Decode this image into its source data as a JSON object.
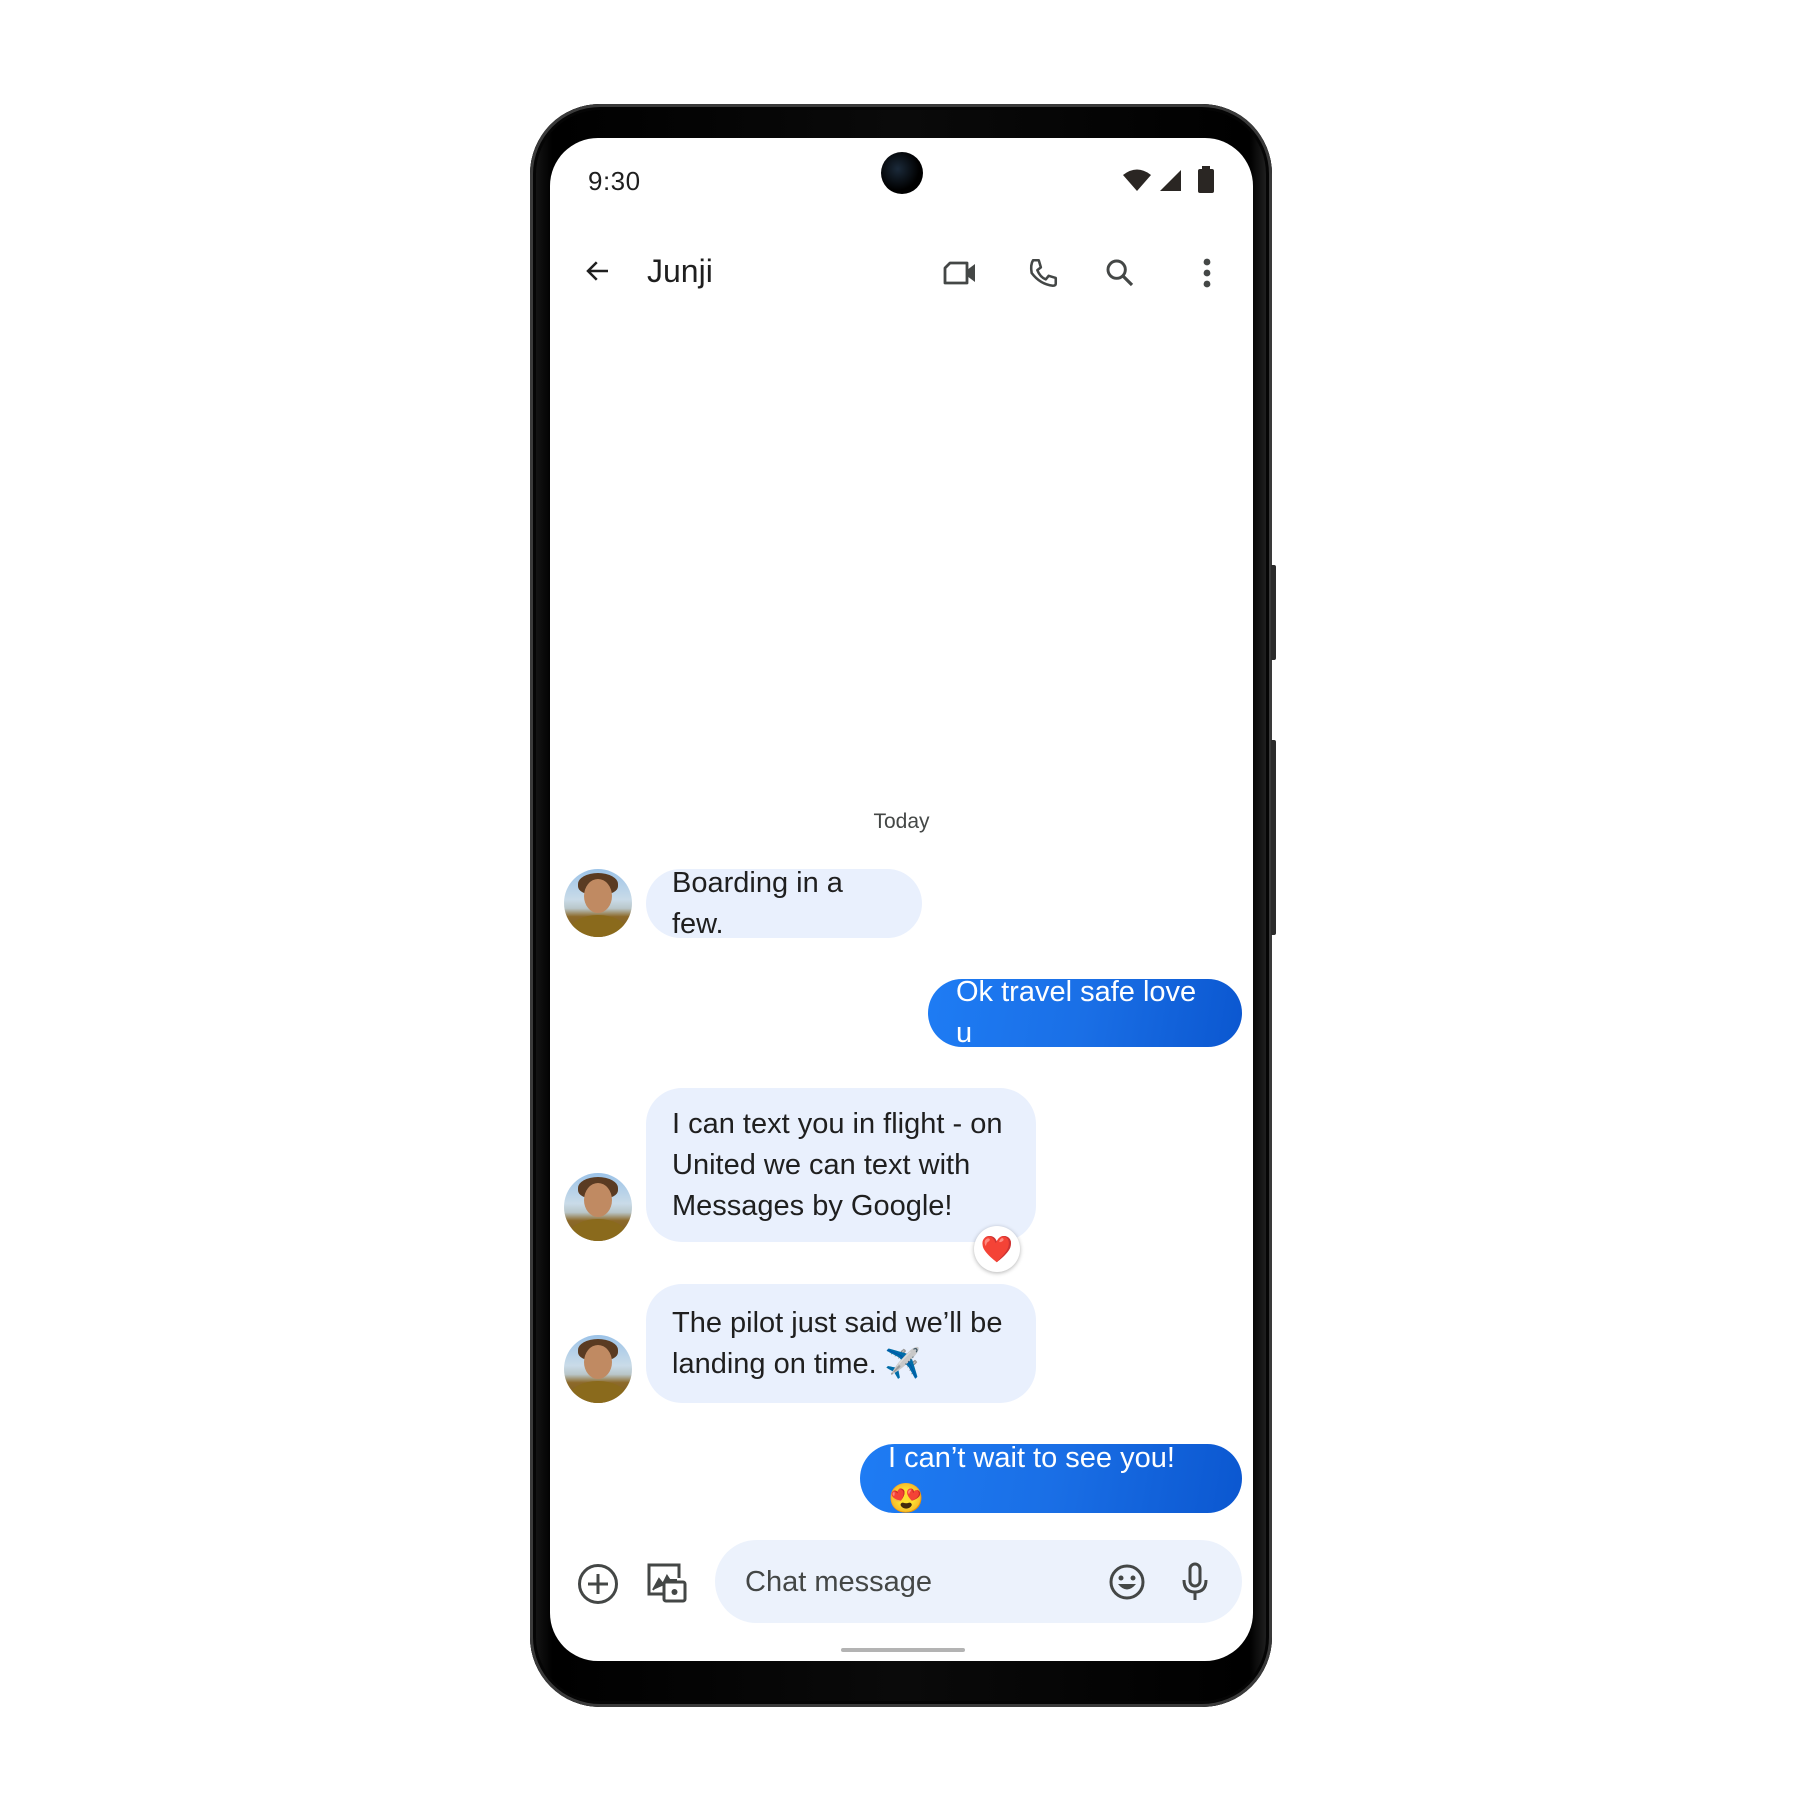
{
  "status_bar": {
    "time": "9:30",
    "icons": [
      "wifi-icon",
      "cellular-signal-icon",
      "battery-icon"
    ]
  },
  "header": {
    "back_icon": "arrow-back-icon",
    "contact_name": "Junji",
    "actions": [
      {
        "name": "video-call",
        "icon": "videocam-icon"
      },
      {
        "name": "voice-call",
        "icon": "phone-icon"
      },
      {
        "name": "search",
        "icon": "search-icon"
      },
      {
        "name": "more-options",
        "icon": "more-vert-icon"
      }
    ]
  },
  "conversation": {
    "date_divider": "Today",
    "messages": [
      {
        "direction": "incoming",
        "text": "Boarding in a few.",
        "avatar": true
      },
      {
        "direction": "outgoing",
        "text": "Ok travel safe love u"
      },
      {
        "direction": "incoming",
        "text": "I can text you in flight - on United we can text with Messages by Google!",
        "avatar": true,
        "reaction": "❤️"
      },
      {
        "direction": "incoming",
        "text": "The pilot just said we’ll be landing on time. ✈️",
        "avatar": true
      },
      {
        "direction": "outgoing",
        "text": "I can’t wait to see you! 😍"
      }
    ]
  },
  "composer": {
    "add_icon": "add-circle-icon",
    "gallery_icon": "gallery-camera-icon",
    "placeholder": "Chat message",
    "value": "",
    "emoji_icon": "emoji-icon",
    "mic_icon": "mic-icon"
  },
  "colors": {
    "outgoing_bubble_start": "#1e7cf4",
    "outgoing_bubble_end": "#0b57d0",
    "incoming_bubble": "#e9f0fd",
    "composer_bg": "#ecf2fc",
    "icon_color": "#444746"
  }
}
